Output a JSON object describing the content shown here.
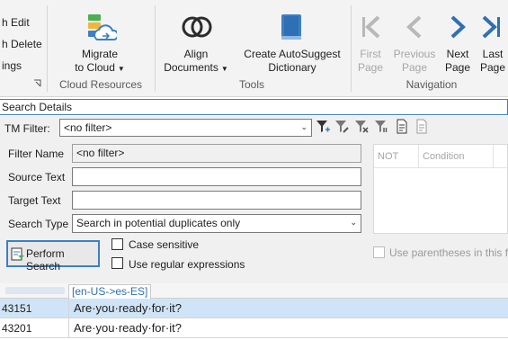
{
  "ribbon": {
    "left_items": [
      "h Edit",
      "h Delete",
      "ings"
    ],
    "migrate": {
      "line1": "Migrate",
      "line2": "to Cloud"
    },
    "cloud_group_label": "Cloud Resources",
    "align": {
      "line1": "Align",
      "line2": "Documents"
    },
    "autosuggest": {
      "line1": "Create AutoSuggest",
      "line2": "Dictionary"
    },
    "tools_group_label": "Tools",
    "first_page": {
      "line1": "First",
      "line2": "Page"
    },
    "previous_page": {
      "line1": "Previous",
      "line2": "Page"
    },
    "next_page": {
      "line1": "Next",
      "line2": "Page"
    },
    "last_page": {
      "line1": "Last",
      "line2": "Page"
    },
    "nav_group_label": "Navigation",
    "colors": {
      "accent": "#3c80c3",
      "migrate_green": "#4caf50",
      "nav_active": "#2f6fb5",
      "nav_disabled": "#b8b8b8"
    }
  },
  "search_details": {
    "title": "Search Details",
    "tm_filter_label": "TM Filter:",
    "tm_filter_value": "<no filter>",
    "filter_name_label": "Filter Name",
    "filter_name_value": "<no filter>",
    "source_text_label": "Source Text",
    "target_text_label": "Target Text",
    "search_type_label": "Search Type",
    "search_type_value": "Search in potential duplicates only",
    "perform_search_label": "Perform Search",
    "case_sensitive_label": "Case sensitive",
    "regex_label": "Use regular expressions",
    "grid_col_not": "NOT",
    "grid_col_condition": "Condition",
    "parentheses_label": "Use parentheses in this fil"
  },
  "results": {
    "tab_label": "[en-US->es-ES]",
    "rows": [
      {
        "id": "43151",
        "text": "Are·you·ready·for·it?"
      },
      {
        "id": "43201",
        "text": "Are·you·ready·for·it?"
      }
    ]
  }
}
